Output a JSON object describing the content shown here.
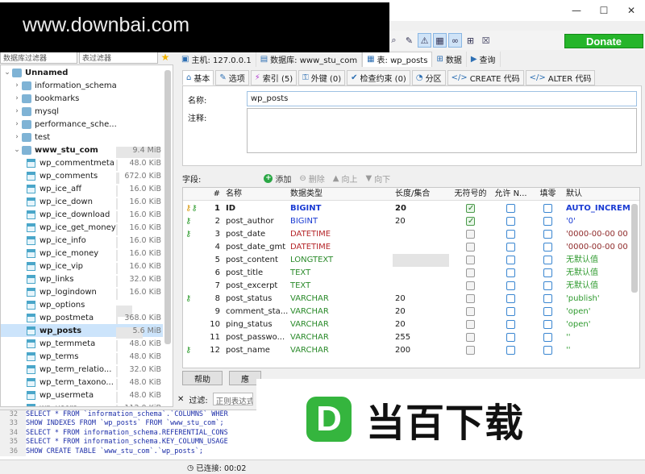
{
  "watermark_top": "www.downbai.com",
  "window_controls": {
    "minimize": "—",
    "maximize": "☐",
    "close": "✕"
  },
  "toolbar": {
    "icons": [
      "search-icon",
      "brush-icon",
      "warning-icon",
      "binary-icon",
      "link-icon",
      "grid-icon",
      "close-icon"
    ],
    "donate_label": "Donate",
    "colors": {
      "donate_bg": "#25b52a",
      "selected_row": "#cce4fb"
    }
  },
  "left": {
    "filter_db": "数据库过滤器",
    "filter_table": "表过滤器",
    "tree": [
      {
        "label": "Unnamed",
        "kind": "conn",
        "expanded": true,
        "bold": true,
        "size": ""
      },
      {
        "label": "information_schema",
        "kind": "db",
        "size": ""
      },
      {
        "label": "bookmarks",
        "kind": "db",
        "size": ""
      },
      {
        "label": "mysql",
        "kind": "db",
        "size": ""
      },
      {
        "label": "performance_sche...",
        "kind": "db",
        "size": ""
      },
      {
        "label": "test",
        "kind": "db",
        "size": ""
      },
      {
        "label": "www_stu_com",
        "kind": "db-open",
        "bold": true,
        "size": "9.4 MiB"
      },
      {
        "label": "wp_commentmeta",
        "kind": "table",
        "size": "48.0 KiB"
      },
      {
        "label": "wp_comments",
        "kind": "table",
        "size": "672.0 KiB"
      },
      {
        "label": "wp_ice_aff",
        "kind": "table",
        "size": "16.0 KiB"
      },
      {
        "label": "wp_ice_down",
        "kind": "table",
        "size": "16.0 KiB"
      },
      {
        "label": "wp_ice_download",
        "kind": "table",
        "size": "16.0 KiB"
      },
      {
        "label": "wp_ice_get_money",
        "kind": "table",
        "size": "16.0 KiB"
      },
      {
        "label": "wp_ice_info",
        "kind": "table",
        "size": "16.0 KiB"
      },
      {
        "label": "wp_ice_money",
        "kind": "table",
        "size": "16.0 KiB"
      },
      {
        "label": "wp_ice_vip",
        "kind": "table",
        "size": "16.0 KiB"
      },
      {
        "label": "wp_links",
        "kind": "table",
        "size": "32.0 KiB"
      },
      {
        "label": "wp_logindown",
        "kind": "table",
        "size": "16.0 KiB"
      },
      {
        "label": "wp_options",
        "kind": "table",
        "size": ""
      },
      {
        "label": "wp_postmeta",
        "kind": "table",
        "size": "368.0 KiB"
      },
      {
        "label": "wp_posts",
        "kind": "table",
        "bold": true,
        "selected": true,
        "size": "5.6 MiB"
      },
      {
        "label": "wp_termmeta",
        "kind": "table",
        "size": "48.0 KiB"
      },
      {
        "label": "wp_terms",
        "kind": "table",
        "size": "48.0 KiB"
      },
      {
        "label": "wp_term_relatio...",
        "kind": "table",
        "size": "32.0 KiB"
      },
      {
        "label": "wp_term_taxono...",
        "kind": "table",
        "size": "48.0 KiB"
      },
      {
        "label": "wp_usermeta",
        "kind": "table",
        "size": "48.0 KiB"
      },
      {
        "label": "wp_users",
        "kind": "table",
        "size": "112.0 KiB"
      }
    ]
  },
  "tabs_top": [
    {
      "label": "主机: 127.0.0.1"
    },
    {
      "label": "数据库: www_stu_com"
    },
    {
      "label": "表: wp_posts",
      "active": true
    },
    {
      "label": "数据"
    },
    {
      "label": "查询"
    }
  ],
  "subtabs": [
    {
      "label": "基本",
      "active": true
    },
    {
      "label": "选项"
    },
    {
      "label": "索引 (5)"
    },
    {
      "label": "外键 (0)"
    },
    {
      "label": "检查约束 (0)"
    },
    {
      "label": "分区"
    },
    {
      "label": "CREATE 代码"
    },
    {
      "label": "ALTER 代码"
    }
  ],
  "form": {
    "name_label": "名称:",
    "name_value": "wp_posts",
    "comment_label": "注释:"
  },
  "fields_bar": {
    "label": "字段:",
    "add": "添加",
    "delete": "删除",
    "up": "向上",
    "down": "向下"
  },
  "columns_header": [
    "#",
    "名称",
    "数据类型",
    "长度/集合",
    "无符号的",
    "允许 N...",
    "填零",
    "默认"
  ],
  "columns": [
    {
      "num": "1",
      "name": "ID",
      "type": "BIGINT",
      "tcolor": "blue",
      "len": "20",
      "unsigned": true,
      "nullable": false,
      "zerofill": false,
      "def": "AUTO_INCREM",
      "dcolor": "blue",
      "keys": [
        "gold",
        "green"
      ],
      "bold": true
    },
    {
      "num": "2",
      "name": "post_author",
      "type": "BIGINT",
      "tcolor": "blue",
      "len": "20",
      "unsigned": true,
      "nullable": false,
      "zerofill": false,
      "def": "'0'",
      "dcolor": "blue",
      "keys": [
        "green"
      ]
    },
    {
      "num": "3",
      "name": "post_date",
      "type": "DATETIME",
      "tcolor": "red",
      "len": "",
      "unsigned": false,
      "nullable": false,
      "zerofill": false,
      "def": "'0000-00-00 00",
      "dcolor": "maroon",
      "keys": [
        "green"
      ]
    },
    {
      "num": "4",
      "name": "post_date_gmt",
      "type": "DATETIME",
      "tcolor": "red",
      "len": "",
      "unsigned": false,
      "nullable": false,
      "zerofill": false,
      "def": "'0000-00-00 00",
      "dcolor": "maroon",
      "keys": []
    },
    {
      "num": "5",
      "name": "post_content",
      "type": "LONGTEXT",
      "tcolor": "green",
      "len": "",
      "len_hl": true,
      "unsigned": false,
      "nullable": false,
      "zerofill": false,
      "def": "无默认值",
      "dcolor": "green",
      "keys": []
    },
    {
      "num": "6",
      "name": "post_title",
      "type": "TEXT",
      "tcolor": "green",
      "len": "",
      "unsigned": false,
      "nullable": false,
      "zerofill": false,
      "def": "无默认值",
      "dcolor": "green",
      "keys": []
    },
    {
      "num": "7",
      "name": "post_excerpt",
      "type": "TEXT",
      "tcolor": "green",
      "len": "",
      "unsigned": false,
      "nullable": false,
      "zerofill": false,
      "def": "无默认值",
      "dcolor": "green",
      "keys": []
    },
    {
      "num": "8",
      "name": "post_status",
      "type": "VARCHAR",
      "tcolor": "green",
      "len": "20",
      "unsigned": false,
      "nullable": false,
      "zerofill": false,
      "def": "'publish'",
      "dcolor": "green",
      "keys": [
        "green"
      ]
    },
    {
      "num": "9",
      "name": "comment_sta...",
      "type": "VARCHAR",
      "tcolor": "green",
      "len": "20",
      "unsigned": false,
      "nullable": false,
      "zerofill": false,
      "def": "'open'",
      "dcolor": "green",
      "keys": []
    },
    {
      "num": "10",
      "name": "ping_status",
      "type": "VARCHAR",
      "tcolor": "green",
      "len": "20",
      "unsigned": false,
      "nullable": false,
      "zerofill": false,
      "def": "'open'",
      "dcolor": "green",
      "keys": []
    },
    {
      "num": "11",
      "name": "post_passwo...",
      "type": "VARCHAR",
      "tcolor": "green",
      "len": "255",
      "unsigned": false,
      "nullable": false,
      "zerofill": false,
      "def": "''",
      "dcolor": "green",
      "keys": []
    },
    {
      "num": "12",
      "name": "post_name",
      "type": "VARCHAR",
      "tcolor": "green",
      "len": "200",
      "unsigned": false,
      "nullable": false,
      "zerofill": false,
      "def": "''",
      "dcolor": "green",
      "keys": [
        "green"
      ]
    }
  ],
  "buttons": {
    "help": "帮助",
    "second": "應"
  },
  "filter": {
    "label": "过滤:",
    "placeholder": "正则表达式"
  },
  "log": [
    {
      "ln": "32",
      "q": "SELECT * FROM `information_schema`.`COLUMNS` WHER"
    },
    {
      "ln": "33",
      "q": "SHOW INDEXES FROM `wp_posts` FROM `www_stu_com`;"
    },
    {
      "ln": "34",
      "q": "SELECT * FROM information_schema.REFERENTIAL_CONS"
    },
    {
      "ln": "35",
      "q": "SELECT * FROM information_schema.KEY_COLUMN_USAGE"
    },
    {
      "ln": "36",
      "q": "SHOW CREATE TABLE `www_stu_com`.`wp_posts`;"
    }
  ],
  "status": {
    "connected": "已连接: 00:02"
  },
  "brand": {
    "logo_letter": "D",
    "name": "当百下载",
    "logo_color": "#35b53e"
  }
}
